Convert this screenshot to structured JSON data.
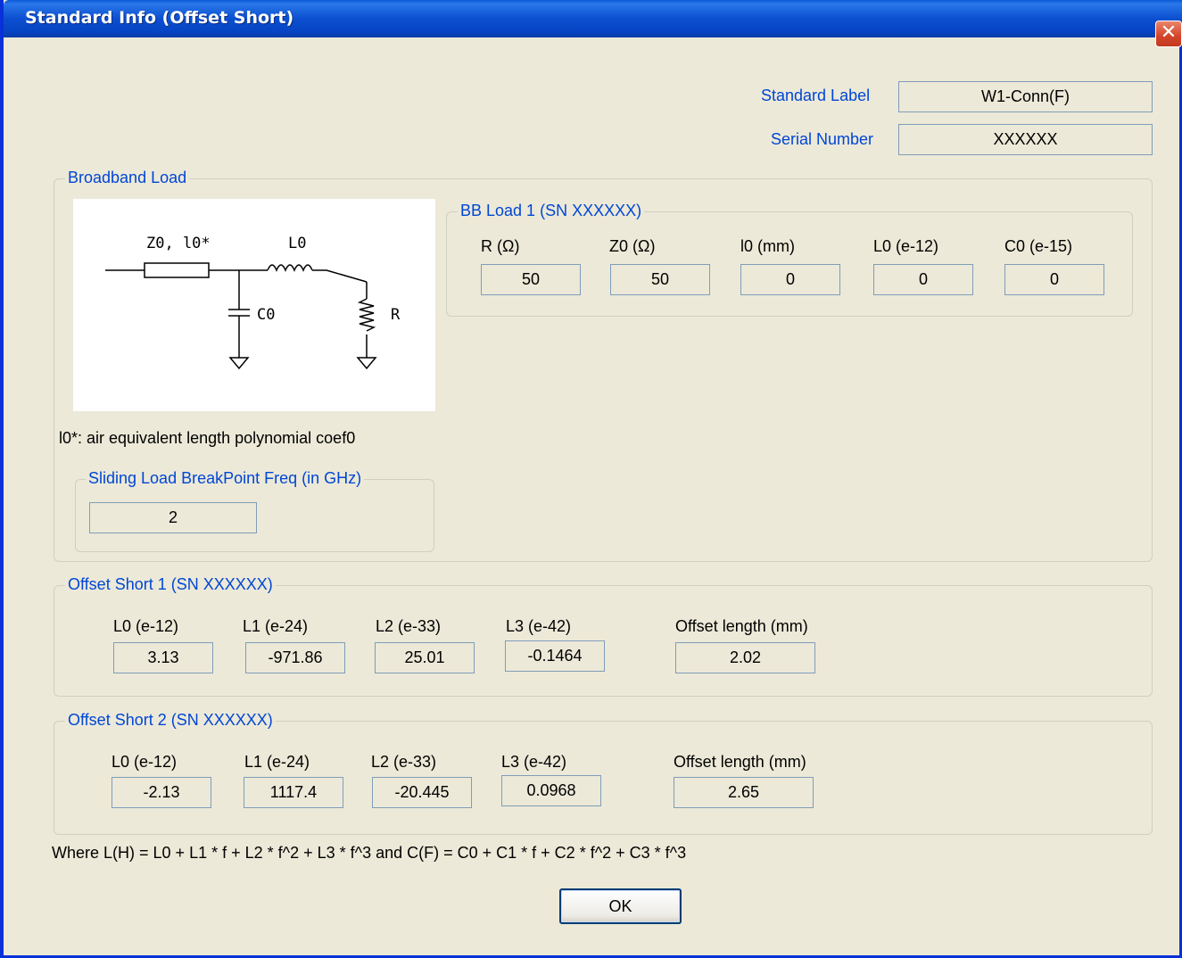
{
  "window": {
    "title": "Standard Info (Offset Short)",
    "close_glyph": "✕"
  },
  "header": {
    "standard_label": "Standard Label",
    "standard_label_value": "W1-Conn(F)",
    "serial_number": "Serial Number",
    "serial_number_value": "XXXXXX"
  },
  "broadband": {
    "legend": "Broadband Load",
    "diagram": {
      "z0_l0": "Z0, l0*",
      "l0": "L0",
      "c0": "C0",
      "r": "R"
    },
    "note": "l0*: air equivalent length polynomial coef0",
    "sliding": {
      "legend": "Sliding Load BreakPoint Freq (in GHz)",
      "value": "2"
    },
    "bb_load": {
      "legend": "BB Load 1 (SN XXXXXX)",
      "headers": [
        "R (Ω)",
        "Z0 (Ω)",
        "l0 (mm)",
        "L0 (e-12)",
        "C0 (e-15)"
      ],
      "values": [
        "50",
        "50",
        "0",
        "0",
        "0"
      ]
    }
  },
  "offset_short_1": {
    "legend": "Offset Short 1 (SN XXXXXX)",
    "headers": [
      "L0 (e-12)",
      "L1 (e-24)",
      "L2 (e-33)",
      "L3 (e-42)",
      "Offset length (mm)"
    ],
    "values": [
      "3.13",
      "-971.86",
      "25.01",
      "-0.1464",
      "2.02"
    ]
  },
  "offset_short_2": {
    "legend": "Offset Short 2 (SN XXXXXX)",
    "headers": [
      "L0 (e-12)",
      "L1 (e-24)",
      "L2 (e-33)",
      "L3 (e-42)",
      "Offset length (mm)"
    ],
    "values": [
      "-2.13",
      "1117.4",
      "-20.445",
      "0.0968",
      "2.65"
    ]
  },
  "formula": "Where L(H) = L0 + L1 * f + L2 * f^2 + L3 * f^3  and  C(F) = C0 + C1 * f + C2 * f^2 + C3 * f^3",
  "ok_label": "OK",
  "colors": {
    "title_blue": "#0a5bd6",
    "label_blue": "#0046d5",
    "dialog_bg": "#ece9d8",
    "close_red": "#d3442a"
  }
}
